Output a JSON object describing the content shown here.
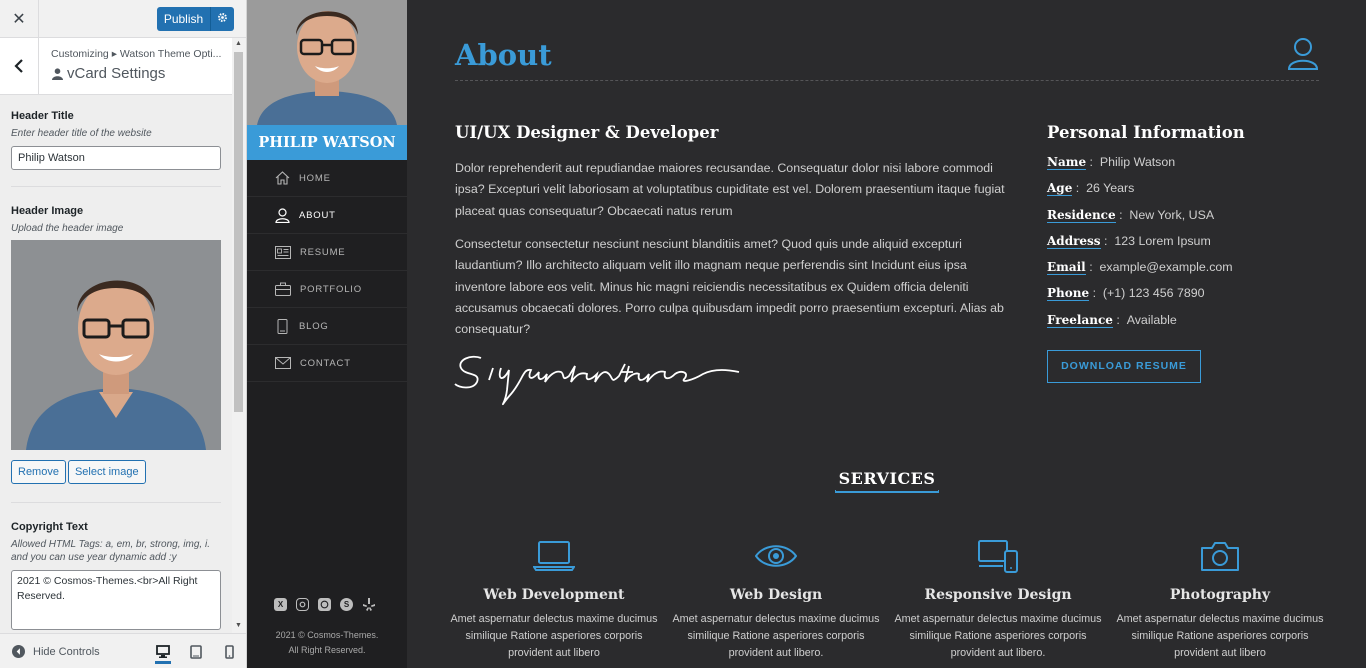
{
  "customizer": {
    "close_label": "✕",
    "publish_label": "Publish",
    "breadcrumb": "Customizing ▸ Watson Theme Opti...",
    "section_title": "vCard Settings",
    "header_title": {
      "label": "Header Title",
      "description": "Enter header title of the website",
      "value": "Philip Watson"
    },
    "header_image": {
      "label": "Header Image",
      "description": "Upload the header image",
      "remove_label": "Remove",
      "select_label": "Select image"
    },
    "copyright": {
      "label": "Copyright Text",
      "description": "Allowed HTML Tags: a, em, br, strong, img, i. and you can use year dynamic add :y",
      "value": "2021 © Cosmos-Themes.<br>All Right Reserved."
    },
    "hide_controls_label": "Hide Controls"
  },
  "sidebar": {
    "name": "PHILIP WATSON",
    "nav": [
      {
        "label": "HOME",
        "icon": "home-icon"
      },
      {
        "label": "ABOUT",
        "icon": "user-icon"
      },
      {
        "label": "RESUME",
        "icon": "resume-icon"
      },
      {
        "label": "PORTFOLIO",
        "icon": "briefcase-icon"
      },
      {
        "label": "BLOG",
        "icon": "tablet-icon"
      },
      {
        "label": "CONTACT",
        "icon": "envelope-icon"
      }
    ],
    "social_icons": [
      "xing-icon",
      "instagram-icon",
      "whatsapp-icon",
      "skype-icon",
      "yelp-icon"
    ],
    "copyright_line1": "2021 © Cosmos-Themes.",
    "copyright_line2": "All Right Reserved."
  },
  "about": {
    "title": "About",
    "role": "UI/UX Designer & Developer",
    "paragraph1": "Dolor reprehenderit aut repudiandae maiores recusandae. Consequatur dolor nisi labore commodi ipsa? Excepturi velit laboriosam at voluptatibus cupiditate est vel. Dolorem praesentium itaque fugiat placeat quas consequatur? Obcaecati natus rerum",
    "paragraph2": "Consectetur consectetur nesciunt nesciunt blanditiis amet? Quod quis unde aliquid excepturi laudantium? Illo architecto aliquam velit illo magnam neque perferendis sint Incidunt eius ipsa inventore labore eos velit. Minus hic magni reiciendis necessitatibus ex Quidem officia deleniti accusamus obcaecati dolores. Porro culpa quibusdam impedit porro praesentium excepturi. Alias ab consequatur?",
    "signature": "Signature"
  },
  "personal_info": {
    "title": "Personal Information",
    "items": [
      {
        "key": "Name",
        "value": "Philip Watson"
      },
      {
        "key": "Age",
        "value": "26 Years"
      },
      {
        "key": "Residence",
        "value": "New York, USA"
      },
      {
        "key": "Address",
        "value": "123 Lorem Ipsum"
      },
      {
        "key": "Email",
        "value": "example@example.com"
      },
      {
        "key": "Phone",
        "value": "(+1) 123 456 7890"
      },
      {
        "key": "Freelance",
        "value": "Available"
      }
    ],
    "download_label": "DOWNLOAD RESUME"
  },
  "services": {
    "title": "SERVICES",
    "items": [
      {
        "name": "Web Development",
        "icon": "laptop-icon",
        "description": "Amet aspernatur delectus maxime ducimus similique Ratione asperiores corporis provident aut libero"
      },
      {
        "name": "Web Design",
        "icon": "eye-icon",
        "description": "Amet aspernatur delectus maxime ducimus similique Ratione asperiores corporis provident aut libero."
      },
      {
        "name": "Responsive Design",
        "icon": "devices-icon",
        "description": "Amet aspernatur delectus maxime ducimus similique Ratione asperiores corporis provident aut libero."
      },
      {
        "name": "Photography",
        "icon": "camera-icon",
        "description": "Amet aspernatur delectus maxime ducimus similique Ratione asperiores corporis provident aut libero"
      }
    ]
  },
  "colors": {
    "accent": "#3a9bd8",
    "wp_blue": "#2271b1",
    "main_bg": "#2b2b2d",
    "sidebar_bg": "#1f1f21"
  }
}
